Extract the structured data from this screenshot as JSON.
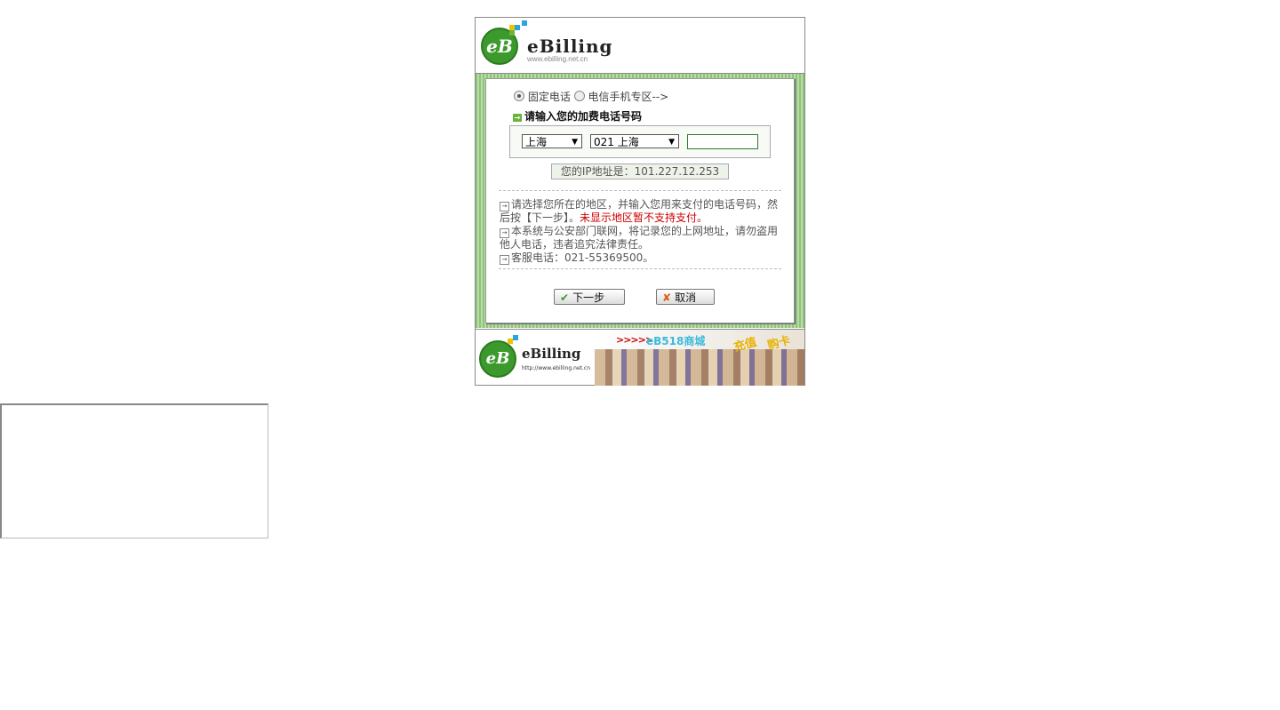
{
  "header": {
    "logo_letters": "eB",
    "brand": "eBilling",
    "url": "www.ebilling.net.cn"
  },
  "form": {
    "radio_fixed_label": "固定电话",
    "radio_mobile_label": "电信手机专区-->",
    "radio_selected": "fixed",
    "prompt": "请输入您的加费电话号码",
    "province_select": "上海",
    "area_select": "021 上海",
    "phone_value": "",
    "ip_label": "您的IP地址是：101.227.12.253"
  },
  "notes": [
    {
      "text": "请选择您所在的地区，并输入您用来支付的电话号码，然后按【下一步】。",
      "highlight": "未显示地区暂不支持支付。"
    },
    {
      "text": "本系统与公安部门联网，将记录您的上网地址，请勿盗用他人电话，违者追究法律责任。",
      "highlight": ""
    },
    {
      "text": "客服电话：021-55369500。",
      "highlight": ""
    }
  ],
  "buttons": {
    "next": "下一步",
    "cancel": "取消"
  },
  "footer": {
    "logo_letters": "eB",
    "brand": "eBilling",
    "url": "http://www.ebilling.net.cn",
    "banner_title": "eB518商城",
    "banner_arrows": ">>>>>",
    "banner_tag1": "充值",
    "banner_tag2": "购卡"
  },
  "colors": {
    "green_brand": "#3c9a2c",
    "stripe_green": "#8fc37a",
    "notice_red": "#cc0000"
  }
}
